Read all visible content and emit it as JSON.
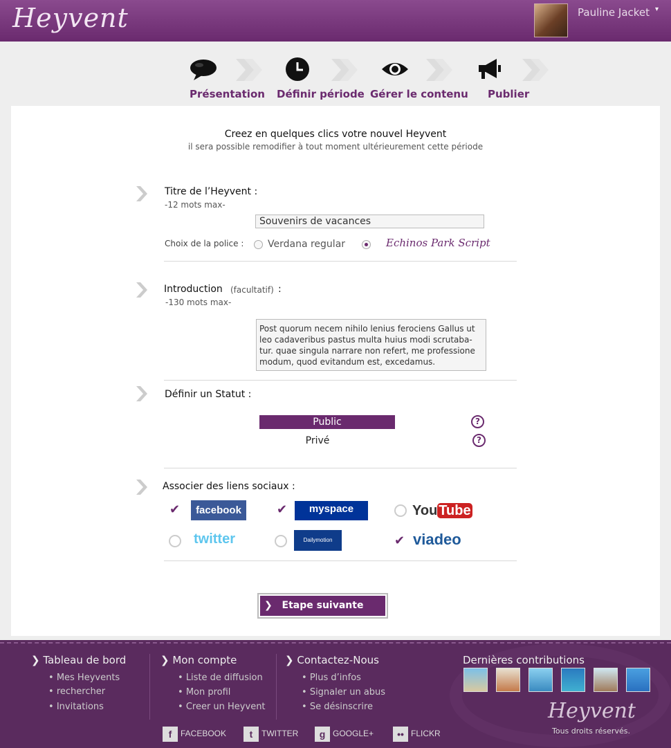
{
  "header": {
    "logo": "Heyvent",
    "username": "Pauline Jacket",
    "caret": "▾"
  },
  "steps": [
    {
      "label": "Présentation",
      "icon": "speech-bubble-icon"
    },
    {
      "label": "Définir période",
      "icon": "clock-icon"
    },
    {
      "label": "Gérer le contenu",
      "icon": "eye-icon"
    },
    {
      "label": "Publier",
      "icon": "megaphone-icon"
    }
  ],
  "intro": {
    "title": "Creez en quelques clics votre nouvel Heyvent",
    "subtitle": "il sera possible remodifier à tout moment ultérieurement cette période"
  },
  "title_section": {
    "heading": "Titre de l’Heyvent :",
    "limit": "-12 mots max-",
    "value": "Souvenirs de vacances",
    "font_label": "Choix de la police :",
    "font_option_1": "Verdana regular",
    "font_option_2": "Echinos Park Script",
    "selected_font": "Echinos Park Script"
  },
  "intro_section": {
    "heading": "Introduction",
    "optional": "(facultatif)",
    "colon": ":",
    "limit": "-130 mots max-",
    "value": "Post quorum necem nihilo lenius ferociens Gallus ut leo cadaveribus pastus multa huius modi scrutaba-tur. quae singula narrare non refert, me professione modum, quod evitandum est, excedamus."
  },
  "status_section": {
    "heading": "Définir un Statut :",
    "public": "Public",
    "private": "Privé",
    "selected": "Public",
    "help": "?"
  },
  "social_section": {
    "heading": "Associer des liens sociaux :",
    "networks": [
      {
        "name": "facebook",
        "checked": true
      },
      {
        "name": "myspace",
        "checked": true
      },
      {
        "name": "YouTube",
        "checked": false
      },
      {
        "name": "twitter",
        "checked": false
      },
      {
        "name": "Dailymotion",
        "checked": false
      },
      {
        "name": "viadeo",
        "checked": true
      }
    ]
  },
  "next_button": "Etape suivante",
  "footer": {
    "col1": {
      "heading": "Tableau de bord",
      "items": [
        "Mes Heyvents",
        "rechercher",
        "Invitations"
      ]
    },
    "col2": {
      "heading": "Mon compte",
      "items": [
        "Liste de diffusion",
        "Mon profil",
        "Creer un Heyvent"
      ]
    },
    "col3": {
      "heading": "Contactez-Nous",
      "items": [
        "Plus d’infos",
        "Signaler un abus",
        "Se désinscrire"
      ]
    },
    "contrib_heading": "Dernières contributions",
    "social": [
      "FACEBOOK",
      "TWITTER",
      "GOOGLE+",
      "FLICKR"
    ],
    "logo": "Heyvent",
    "rights": "Tous droits réservés."
  },
  "colors": {
    "brand": "#6a2a6e",
    "footer": "#5a2b5e",
    "facebook": "#3b5998",
    "myspace": "#003399"
  }
}
